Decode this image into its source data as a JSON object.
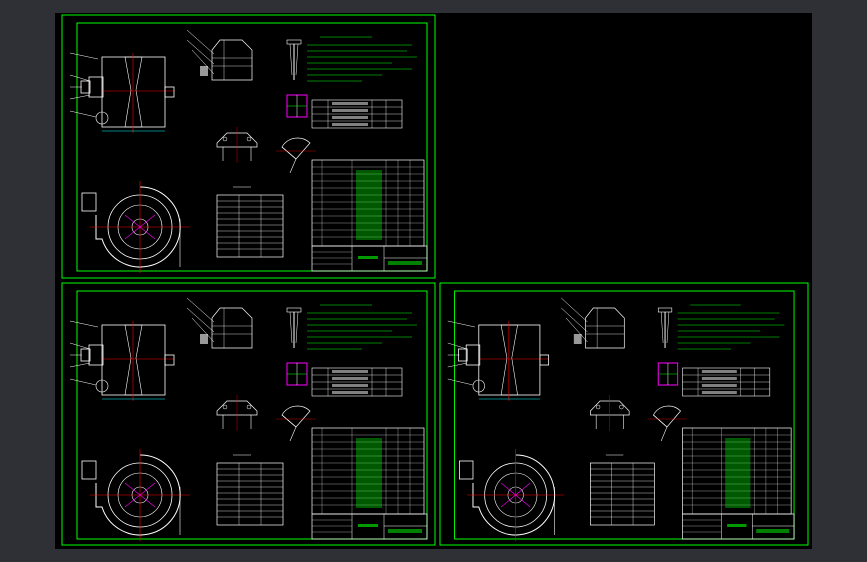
{
  "viewer": {
    "background": "#2f3035",
    "canvas_color": "#000000",
    "sheet_color": "#00ff00",
    "line_color": "#ffffff",
    "cyan": "#00ffff",
    "magenta": "#ff00ff",
    "red": "#ff0000"
  },
  "sheets": [
    {
      "id": "sheet-1",
      "name": "top-left"
    },
    {
      "id": "sheet-2",
      "name": "bottom-left"
    },
    {
      "id": "sheet-3",
      "name": "bottom-right"
    }
  ]
}
